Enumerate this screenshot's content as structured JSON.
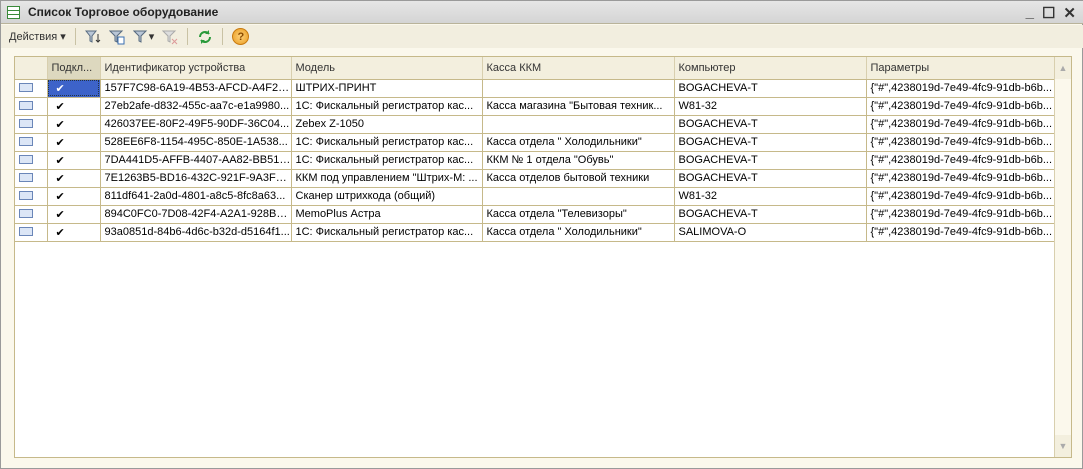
{
  "window": {
    "title": "Список Торговое оборудование",
    "minimize": "_",
    "maximize": "☐",
    "close": "✕"
  },
  "toolbar": {
    "actions_label": "Действия ▾",
    "help": "?"
  },
  "table": {
    "columns": [
      "",
      "Подкл...",
      "Идентификатор устройства",
      "Модель",
      "Касса ККМ",
      "Компьютер",
      "Параметры"
    ],
    "rows": [
      {
        "check": "✔",
        "id": "157F7C98-6A19-4B53-AFCD-A4F2D...",
        "model": "ШТРИХ-ПРИНТ",
        "kassa": "",
        "computer": "BOGACHEVA-T",
        "params": "{\"#\",4238019d-7e49-4fc9-91db-b6b..."
      },
      {
        "check": "✔",
        "id": "27eb2afe-d832-455c-aa7c-e1a9980...",
        "model": "1С: Фискальный регистратор кас...",
        "kassa": "Касса магазина \"Бытовая техник...",
        "computer": "W81-32",
        "params": "{\"#\",4238019d-7e49-4fc9-91db-b6b..."
      },
      {
        "check": "✔",
        "id": "426037EE-80F2-49F5-90DF-36C04...",
        "model": "Zebex Z-1050",
        "kassa": "",
        "computer": "BOGACHEVA-T",
        "params": "{\"#\",4238019d-7e49-4fc9-91db-b6b..."
      },
      {
        "check": "✔",
        "id": "528EE6F8-1154-495C-850E-1A538...",
        "model": "1С: Фискальный регистратор кас...",
        "kassa": "Касса отдела \" Холодильники\"",
        "computer": "BOGACHEVA-T",
        "params": "{\"#\",4238019d-7e49-4fc9-91db-b6b..."
      },
      {
        "check": "✔",
        "id": "7DA441D5-AFFB-4407-AA82-BB513...",
        "model": "1С: Фискальный регистратор кас...",
        "kassa": "ККМ № 1 отдела \"Обувь\"",
        "computer": "BOGACHEVA-T",
        "params": "{\"#\",4238019d-7e49-4fc9-91db-b6b..."
      },
      {
        "check": "✔",
        "id": "7E1263B5-BD16-432C-921F-9A3FE...",
        "model": "ККМ под управлением \"Штрих-М: ...",
        "kassa": "Касса отделов бытовой техники",
        "computer": "BOGACHEVA-T",
        "params": "{\"#\",4238019d-7e49-4fc9-91db-b6b..."
      },
      {
        "check": "✔",
        "id": "811df641-2a0d-4801-a8c5-8fc8a63...",
        "model": "Сканер штрихкода (общий)",
        "kassa": "",
        "computer": "W81-32",
        "params": "{\"#\",4238019d-7e49-4fc9-91db-b6b..."
      },
      {
        "check": "✔",
        "id": "894C0FC0-7D08-42F4-A2A1-928B9...",
        "model": "MemoPlus Астра",
        "kassa": "Касса отдела \"Телевизоры\"",
        "computer": "BOGACHEVA-T",
        "params": "{\"#\",4238019d-7e49-4fc9-91db-b6b..."
      },
      {
        "check": "✔",
        "id": "93a0851d-84b6-4d6c-b32d-d5164f1...",
        "model": "1С: Фискальный регистратор кас...",
        "kassa": "Касса отдела \" Холодильники\"",
        "computer": "SALIMOVA-O",
        "params": "{\"#\",4238019d-7e49-4fc9-91db-b6b..."
      }
    ]
  },
  "scroll": {
    "up": "▲",
    "down": "▼"
  }
}
